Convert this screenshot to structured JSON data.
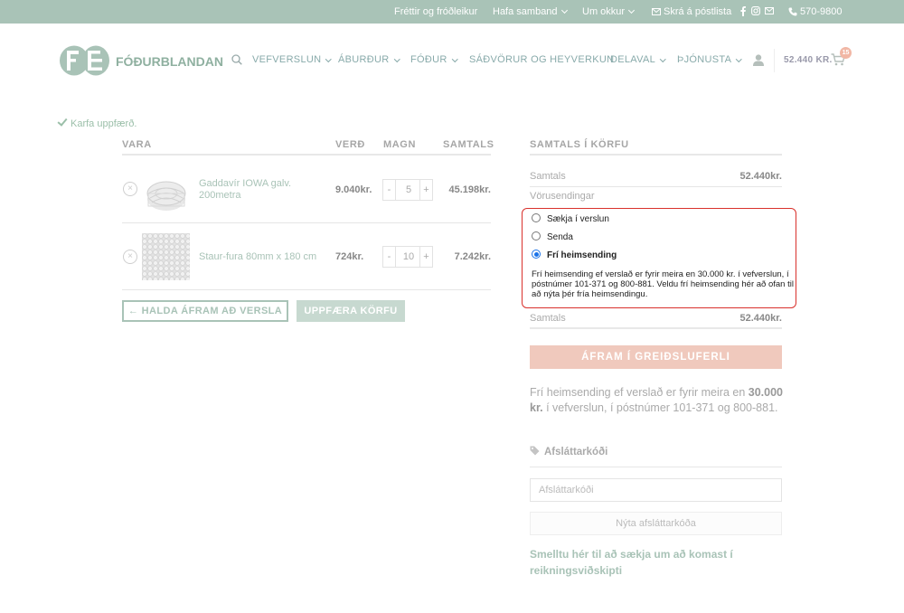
{
  "topbar": {
    "news": "Fréttir og fróðleikur",
    "contact": "Hafa samband",
    "about": "Um okkur",
    "newsletter": "Skrá á póstlista",
    "phone": "570-9800"
  },
  "header": {
    "logo_text": "FÓÐURBLANDAN",
    "nav": [
      "VEFVERSLUN",
      "ÁBURÐUR",
      "FÓÐUR",
      "SÁÐVÖRUR OG HEYVERKUN",
      "DELAVAL",
      "ÞJÓNUSTA"
    ],
    "cart_total": "52.440 KR.",
    "cart_count": "15"
  },
  "notice": "Karfa uppfærð.",
  "cart": {
    "headers": {
      "product": "VARA",
      "price": "VERÐ",
      "qty": "MAGN",
      "total": "SAMTALS"
    },
    "items": [
      {
        "name": "Gaddavír IOWA galv. 200metra",
        "price": "9.040kr.",
        "qty": "5",
        "total": "45.198kr."
      },
      {
        "name": "Staur-fura 80mm x 180 cm",
        "price": "724kr.",
        "qty": "10",
        "total": "7.242kr."
      }
    ],
    "remove_symbol": "×",
    "minus": "-",
    "plus": "+",
    "continue_label": "← HALDA ÁFRAM AÐ VERSLA",
    "update_label": "UPPFÆRA KÖRFU"
  },
  "totals": {
    "heading": "SAMTALS Í KÖRFU",
    "subtotal_label": "Samtals",
    "subtotal_value": "52.440kr.",
    "shipping_label": "Vörusendingar",
    "shipping_options": [
      {
        "label": "Sækja í verslun",
        "selected": false
      },
      {
        "label": "Senda",
        "selected": false
      },
      {
        "label": "Frí heimsending",
        "selected": true
      }
    ],
    "shipping_note": "Frí heimsending ef verslað er fyrir meira en 30.000 kr. í vefverslun, í póstnúmer 101-371 og 800-881. Veldu frí heimsending hér að ofan til að nýta þér fría heimsendingu.",
    "total_label": "Samtals",
    "total_value": "52.440kr.",
    "checkout_label": "ÁFRAM Í GREIÐSLUFERLI"
  },
  "free_shipping": {
    "part1": "Frí heimsending ef verslað er fyrir meira en ",
    "bold": "30.000 kr.",
    "part2": " í vefverslun, í póstnúmer 101-371 og 800-881."
  },
  "coupon": {
    "heading": "Afsláttarkóði",
    "placeholder": "Afsláttarkóði",
    "apply_label": "Nýta afsláttarkóða"
  },
  "account_link": "Smelltu hér til að sækja um að komast í reikningsviðskipti",
  "colors": {
    "topbar": "#a9c3b7",
    "accent": "#a9c3b7",
    "checkout": "#f0c9bd",
    "highlight_border": "#d9312c",
    "radio_selected": "#1a73e8"
  }
}
